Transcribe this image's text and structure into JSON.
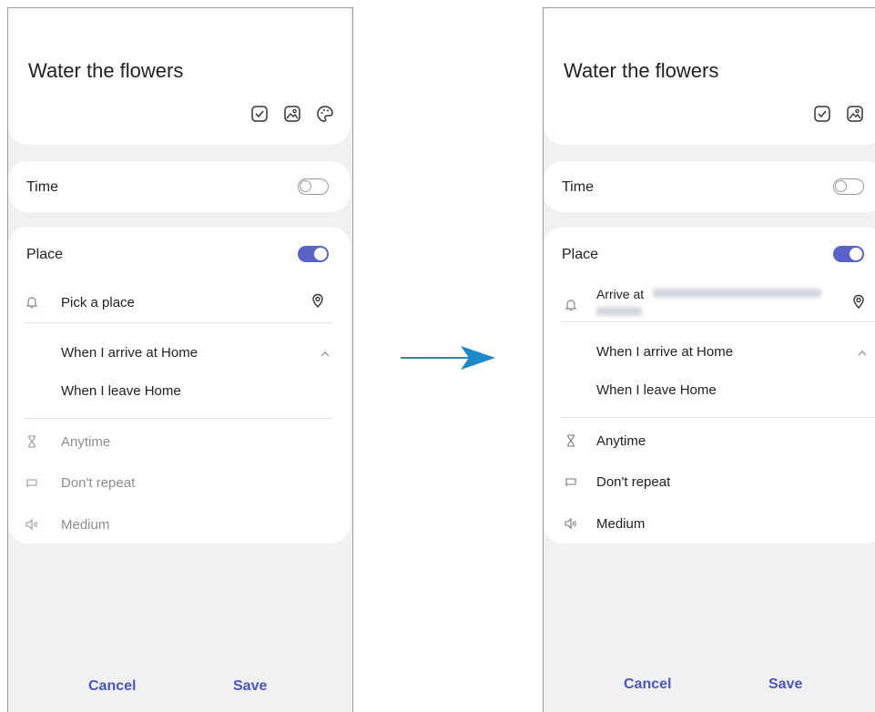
{
  "left": {
    "title": "Water the flowers",
    "time_label": "Time",
    "place_label": "Place",
    "pick_place": "Pick a place",
    "arrive_option": "When I arrive at Home",
    "leave_option": "When I leave Home",
    "anytime": "Anytime",
    "repeat": "Don't repeat",
    "volume": "Medium",
    "cancel": "Cancel",
    "save": "Save"
  },
  "right": {
    "title": "Water the flowers",
    "time_label": "Time",
    "place_label": "Place",
    "arrive_at": "Arrive at",
    "arrive_option": "When I arrive at Home",
    "leave_option": "When I leave Home",
    "anytime": "Anytime",
    "repeat": "Don't repeat",
    "volume": "Medium",
    "cancel": "Cancel",
    "save": "Save"
  },
  "colors": {
    "accent": "#5b63c9",
    "button_text": "#4c57b5",
    "arrow": "#1e88c8"
  }
}
